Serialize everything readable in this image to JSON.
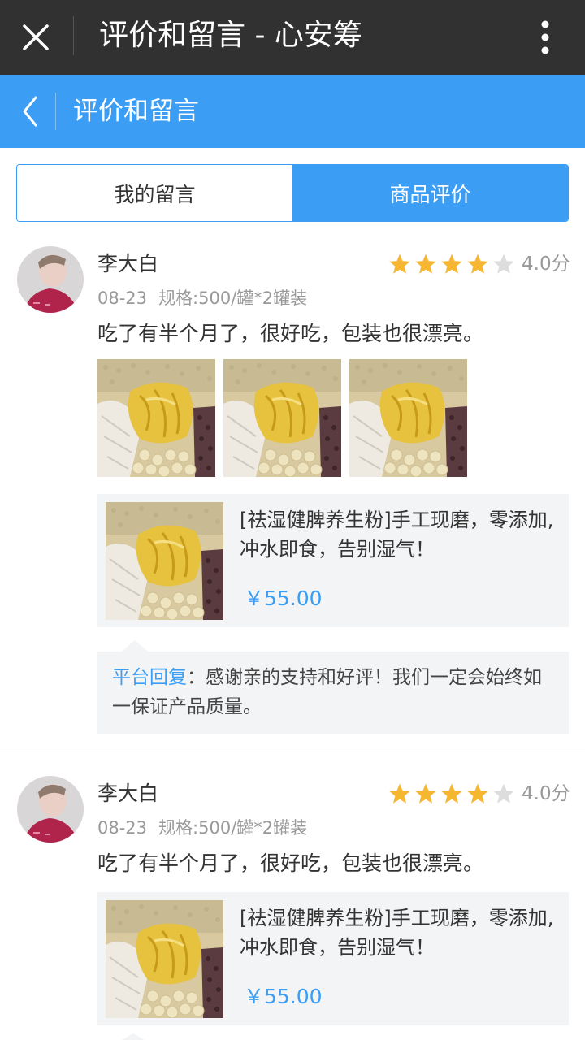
{
  "window": {
    "title": "评价和留言 - 心安筹"
  },
  "nav": {
    "title": "评价和留言"
  },
  "tabs": [
    {
      "label": "我的留言",
      "active": false
    },
    {
      "label": "商品评价",
      "active": true
    }
  ],
  "colors": {
    "accent": "#3b9ef4",
    "star_on": "#f5b731",
    "star_off": "#dddddd",
    "topbar": "#313131"
  },
  "icons": {
    "close": "close-icon",
    "more": "more-vertical-icon",
    "back": "chevron-left-icon",
    "star": "star-icon"
  },
  "reviews": [
    {
      "name": "李大白",
      "rating": 4,
      "score": "4.0分",
      "date": "08-23",
      "spec": "规格:500/罐*2罐装",
      "content": "吃了有半个月了，很好吃，包装也很漂亮。",
      "photo_count": 3,
      "product": {
        "title": "[祛湿健脾养生粉]手工现磨，零添加,冲水即食，告别湿气！",
        "price": "￥55.00"
      },
      "reply": {
        "label": "平台回复",
        "text": "：感谢亲的支持和好评！我们一定会始终如一保证产品质量。"
      }
    },
    {
      "name": "李大白",
      "rating": 4,
      "score": "4.0分",
      "date": "08-23",
      "spec": "规格:500/罐*2罐装",
      "content": "吃了有半个月了，很好吃，包装也很漂亮。",
      "product": {
        "title": "[祛湿健脾养生粉]手工现磨，零添加,冲水即食，告别湿气！",
        "price": "￥55.00"
      }
    }
  ]
}
